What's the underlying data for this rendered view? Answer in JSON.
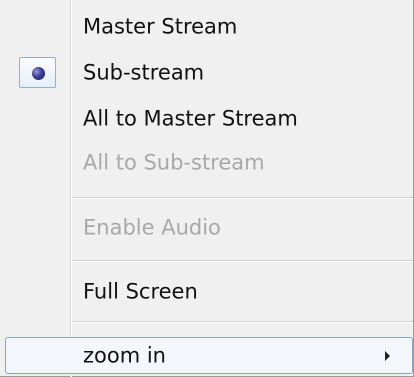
{
  "menu": {
    "items": [
      {
        "label": "Master Stream",
        "enabled": true,
        "selected": false
      },
      {
        "label": "Sub-stream",
        "enabled": true,
        "selected": true
      },
      {
        "label": "All to Master Stream",
        "enabled": true,
        "selected": false
      },
      {
        "label": "All to Sub-stream",
        "enabled": false,
        "selected": false
      },
      {
        "label": "Enable Audio",
        "enabled": false,
        "selected": false
      },
      {
        "label": "Full Screen",
        "enabled": true,
        "selected": false
      },
      {
        "label": "zoom in",
        "enabled": true,
        "selected": false,
        "has_submenu": true,
        "hovered": true
      }
    ],
    "colors": {
      "background": "#f0f0f0",
      "text": "#111111",
      "disabled_text": "#a8a8a8",
      "highlight_border": "#8aa5c4",
      "radio_dot": "#2c2c80"
    },
    "icons": {
      "selected_radio": "radio-dot-icon",
      "submenu_arrow": "chevron-right-icon"
    }
  }
}
